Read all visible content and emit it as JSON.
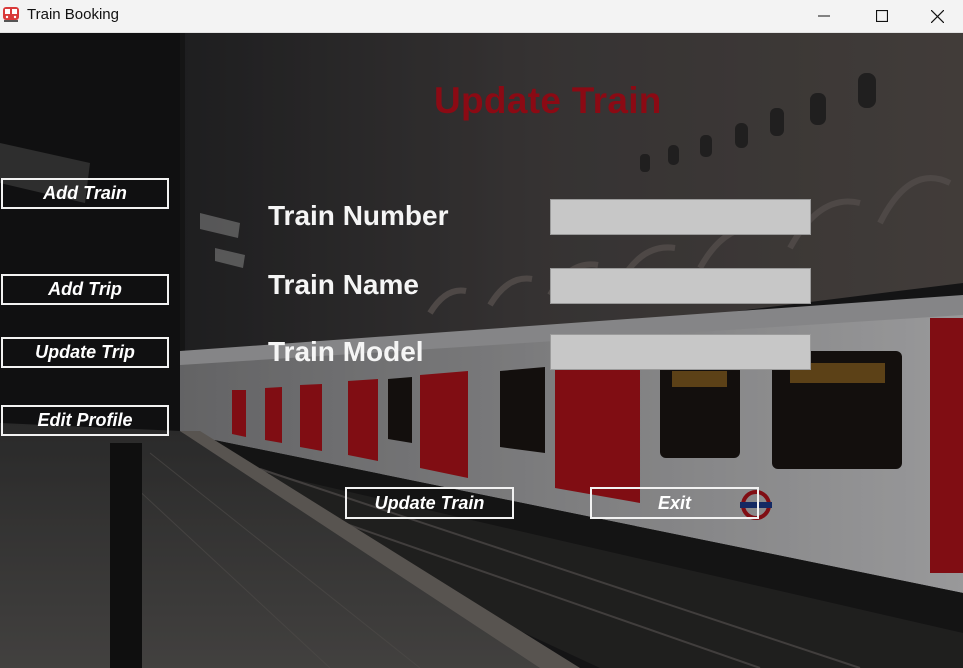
{
  "window": {
    "title": "Train Booking",
    "app_icon": "train-icon",
    "controls": [
      "minimize-icon",
      "maximize-icon",
      "close-icon"
    ]
  },
  "page": {
    "heading": "Update Train",
    "heading_color": "#8b0a14"
  },
  "sidebar": {
    "items": [
      {
        "label": "Add Train"
      },
      {
        "label": "Add Trip"
      },
      {
        "label": "Update Trip"
      },
      {
        "label": "Edit Profile"
      }
    ]
  },
  "form": {
    "fields": [
      {
        "label": "Train Number",
        "value": ""
      },
      {
        "label": "Train Name",
        "value": ""
      },
      {
        "label": "Train Model",
        "value": ""
      }
    ]
  },
  "actions": {
    "update_label": "Update Train",
    "exit_label": "Exit"
  }
}
